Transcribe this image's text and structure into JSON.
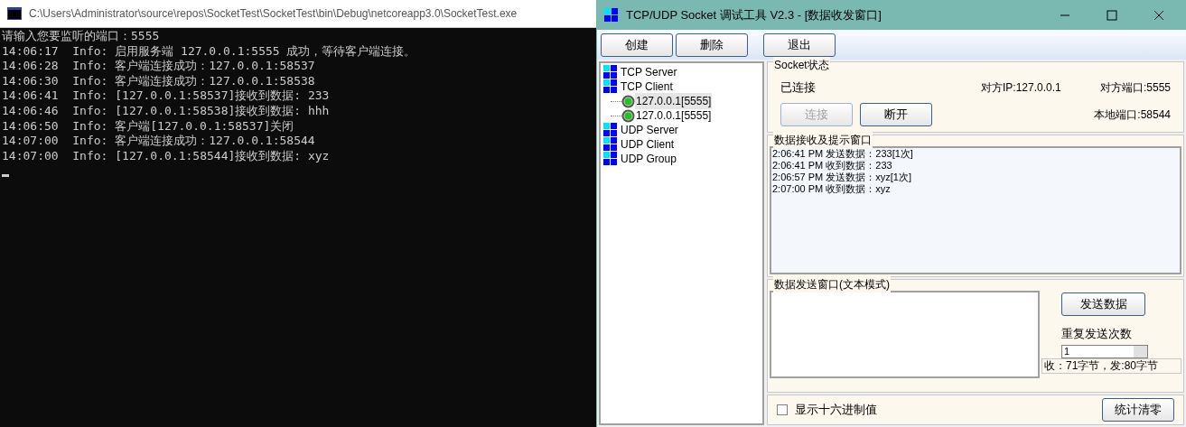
{
  "console": {
    "title": "C:\\Users\\Administrator\\source\\repos\\SocketTest\\SocketTest\\bin\\Debug\\netcoreapp3.0\\SocketTest.exe",
    "lines": [
      "请输入您要监听的端口：5555",
      "14:06:17  Info: 启用服务端 127.0.0.1:5555 成功，等待客户端连接。",
      "14:06:28  Info: 客户端连接成功：127.0.0.1:58537",
      "14:06:30  Info: 客户端连接成功：127.0.0.1:58538",
      "14:06:41  Info: [127.0.0.1:58537]接收到数据: 233",
      "14:06:46  Info: [127.0.0.1:58538]接收到数据: hhh",
      "14:06:50  Info: 客户端[127.0.0.1:58537]关闭",
      "14:07:00  Info: 客户端连接成功：127.0.0.1:58544",
      "14:07:00  Info: [127.0.0.1:58544]接收到数据: xyz"
    ]
  },
  "tool": {
    "title": "TCP/UDP Socket 调试工具 V2.3 - [数据收发窗口]",
    "toolbar": [
      "创建",
      "删除",
      "退出"
    ],
    "tree": [
      {
        "label": "TCP Server"
      },
      {
        "label": "TCP Client",
        "children": [
          {
            "label": "127.0.0.1[5555]",
            "selected": true
          },
          {
            "label": "127.0.0.1[5555]",
            "selected": false
          }
        ]
      },
      {
        "label": "UDP Server"
      },
      {
        "label": "UDP Client"
      },
      {
        "label": "UDP Group"
      }
    ],
    "socket_status": {
      "title": "Socket状态",
      "status": "已连接",
      "peer_ip": "对方IP:127.0.0.1",
      "peer_port": "对方端口:5555",
      "local_port": "本地端口:58544",
      "buttons": [
        {
          "label": "连接",
          "disabled": true
        },
        {
          "label": "断开",
          "disabled": false
        }
      ]
    },
    "receive": {
      "title": "数据接收及提示窗口",
      "lines": [
        "2:06:41 PM 发送数据：233[1次]",
        "2:06:41 PM 收到数据：233",
        "2:06:57 PM 发送数据：xyz[1次]",
        "2:07:00 PM 收到数据：xyz"
      ]
    },
    "send": {
      "title": "数据发送窗口(文本模式)",
      "send_button": "发送数据",
      "repeat_label": "重复发送次数",
      "repeat_value": "1",
      "stats": "收：71字节，发:80字节"
    },
    "hex_checkbox": {
      "label": "显示十六进制值",
      "checked": false
    },
    "clear_button": "统计清零"
  }
}
